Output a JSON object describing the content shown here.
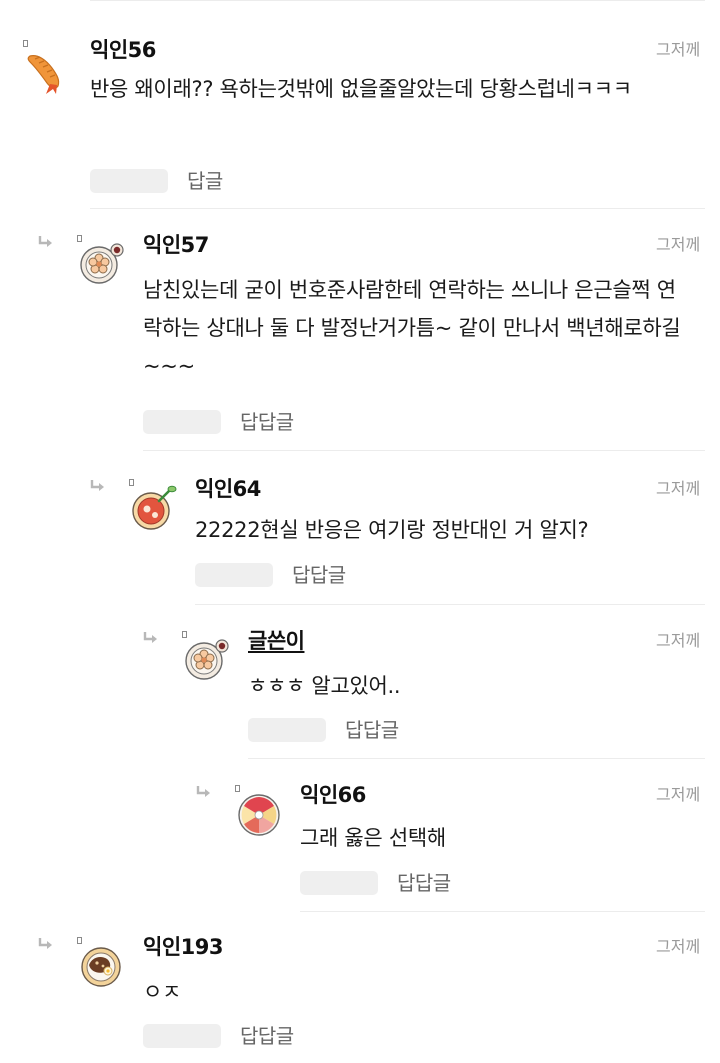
{
  "comments": [
    {
      "nickname": "익인56",
      "time": "그저께",
      "text": "반응 왜이래?? 욕하는것밖에 없을줄알았는데 당황스럽네ㅋㅋㅋ",
      "action_label": "답글",
      "avatar": "shrimp-tempura-icon"
    },
    {
      "nickname": "익인57",
      "time": "그저께",
      "text": "남친있는데 굳이 번호준사람한테 연락하는 쓰니나 은근슬쩍 연락하는 상대나 둘 다 발정난거가틈~ 같이 만나서 백년해로하길~~~",
      "action_label": "답답글",
      "avatar": "flower-dumpling-icon"
    },
    {
      "nickname": "익인64",
      "time": "그저께",
      "text": "22222현실 반응은 여기랑 정반대인 거 알지?",
      "action_label": "답답글",
      "avatar": "curry-bowl-icon"
    },
    {
      "nickname": "글쓴이",
      "time": "그저께",
      "text": "ㅎㅎㅎ 알고있어..",
      "action_label": "답답글",
      "avatar": "flower-dumpling-icon"
    },
    {
      "nickname": "익인66",
      "time": "그저께",
      "text": "그래 옳은 선택해",
      "action_label": "답답글",
      "avatar": "sushi-plate-icon"
    },
    {
      "nickname": "익인193",
      "time": "그저께",
      "text": "ㅇㅈ",
      "action_label": "답답글",
      "avatar": "bibimbap-bowl-icon"
    }
  ],
  "colors": {
    "text": "#111111",
    "muted": "#9a9a9a",
    "divider": "#ececec",
    "pill": "#efefef"
  }
}
